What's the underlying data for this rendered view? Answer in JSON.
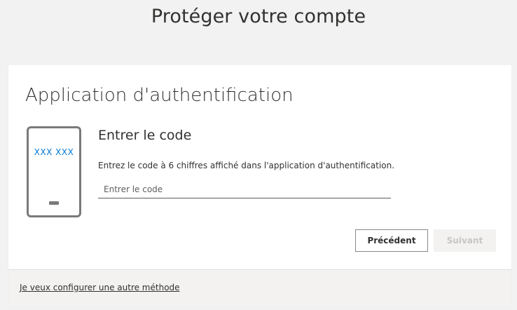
{
  "header": {
    "title": "Protéger votre compte"
  },
  "card": {
    "title": "Application d'authentification",
    "phone_illustration": {
      "code_text": "XXX XXX",
      "accent_color": "#0078d4"
    },
    "section_title": "Entrer le code",
    "instructions": "Entrez le code à 6 chiffres affiché dans l'application d'authentification.",
    "code_input": {
      "value": "",
      "placeholder": "Entrer le code"
    },
    "buttons": {
      "previous_label": "Précédent",
      "next_label": "Suivant",
      "next_disabled": true
    },
    "footer": {
      "link_text": "Je veux configurer une autre méthode"
    }
  }
}
